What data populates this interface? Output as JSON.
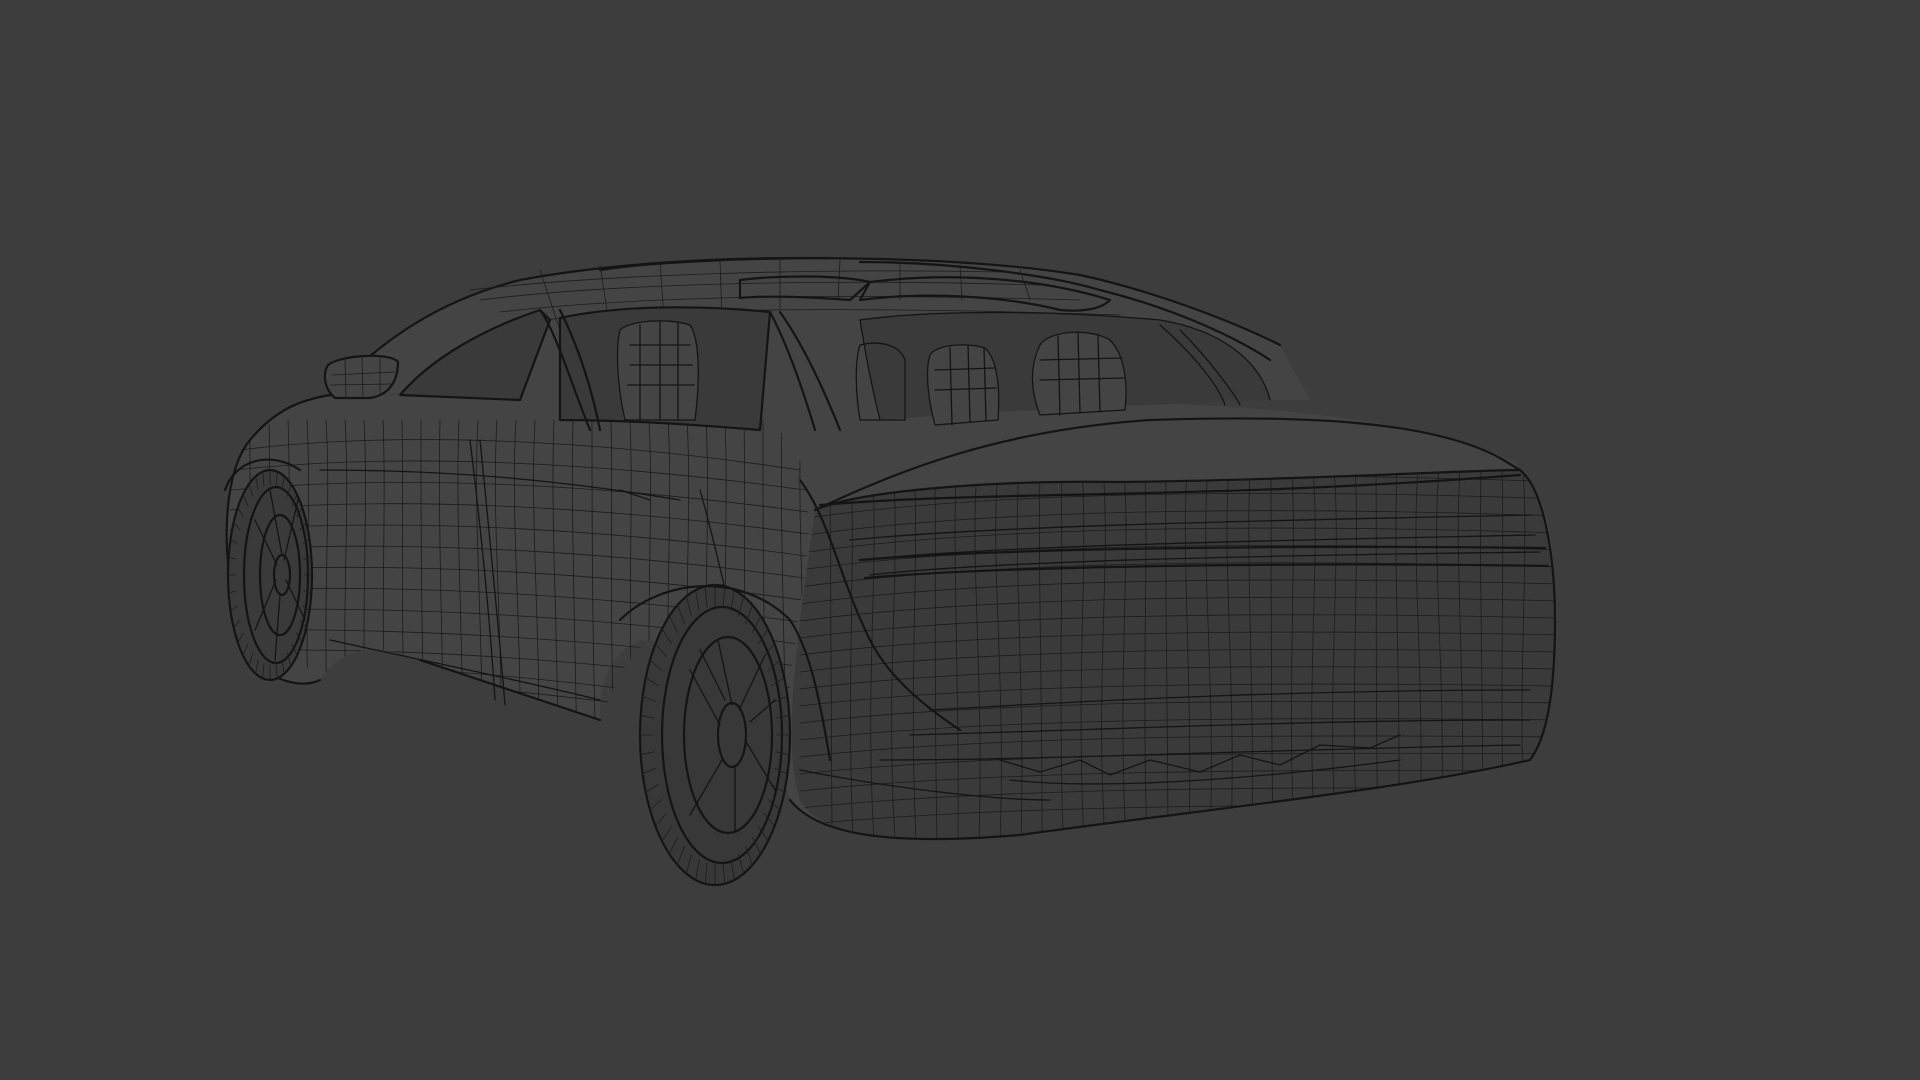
{
  "viewport": {
    "background_color": "#3d3d3d",
    "wire_color": "#141414",
    "shading": "wireframe",
    "subject": "car-3d-model"
  }
}
